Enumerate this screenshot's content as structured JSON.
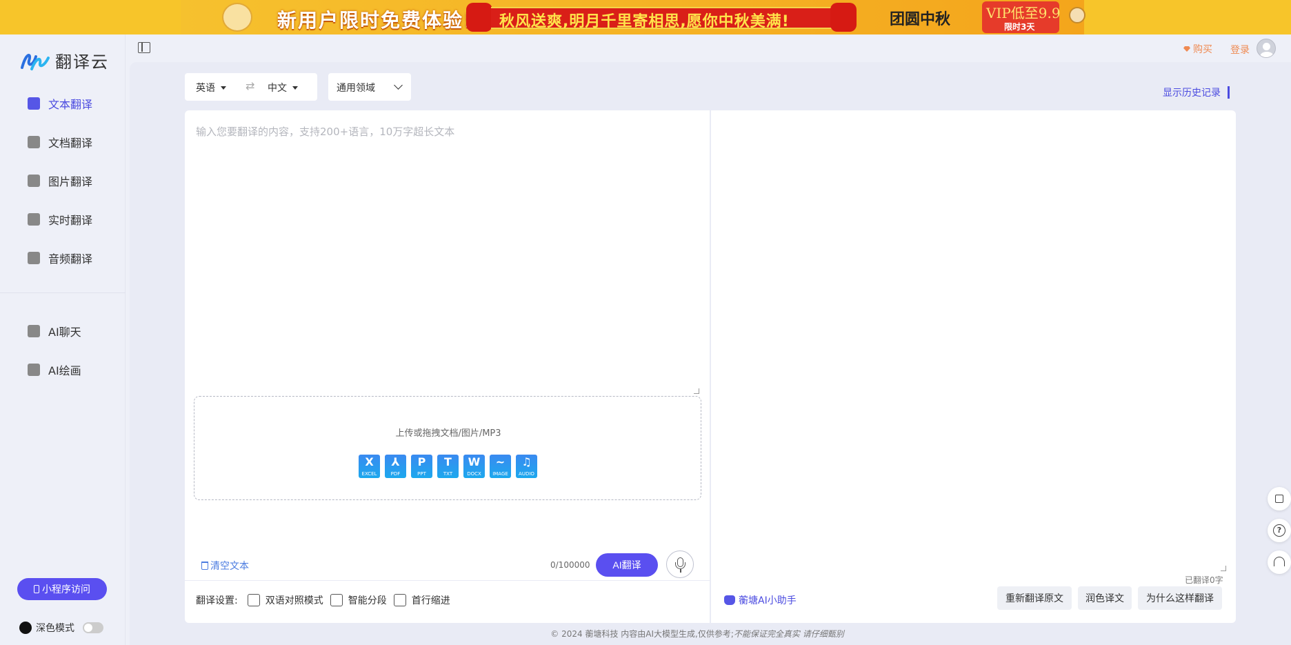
{
  "banner": {
    "headline": "新用户限时免费体验!",
    "ribbon": "秋风送爽,明月千里寄相思,愿你中秋美满!",
    "moon_text": "团圆中秋",
    "vip_text": "VIP低至9.9",
    "vip_sub": "限时3天"
  },
  "logo": {
    "text": "翻译云"
  },
  "sidebar": {
    "items": [
      {
        "label": "文本翻译",
        "icon": "text-translate-icon",
        "active": true
      },
      {
        "label": "文档翻译",
        "icon": "document-translate-icon",
        "active": false
      },
      {
        "label": "图片翻译",
        "icon": "image-translate-icon",
        "active": false
      },
      {
        "label": "实时翻译",
        "icon": "realtime-translate-icon",
        "active": false
      },
      {
        "label": "音频翻译",
        "icon": "audio-translate-icon",
        "active": false
      }
    ],
    "ai_items": [
      {
        "label": "AI聊天",
        "icon": "ai-chat-icon"
      },
      {
        "label": "AI绘画",
        "icon": "ai-paint-icon"
      }
    ],
    "mini_program": "小程序访问",
    "dark_mode": "深色模式"
  },
  "header": {
    "buy": "购买",
    "login": "登录"
  },
  "toolbar": {
    "source_lang": "英语",
    "target_lang": "中文",
    "swap_glyph": "⇄",
    "domain": "通用领域",
    "history": "显示历史记录"
  },
  "source": {
    "placeholder": "输入您要翻译的内容，支持200+语言，10万字超长文本",
    "value": ""
  },
  "upload": {
    "label": "上传或拖拽文档/图片/MP3",
    "file_types": [
      {
        "type": "EXCEL",
        "glyph": "X"
      },
      {
        "type": "PDF",
        "glyph": "⅄"
      },
      {
        "type": "PPT",
        "glyph": "P"
      },
      {
        "type": "TXT",
        "glyph": "T"
      },
      {
        "type": "DOCX",
        "glyph": "W"
      },
      {
        "type": "IMAGE",
        "glyph": "~"
      },
      {
        "type": "AUDIO",
        "glyph": "♫"
      }
    ]
  },
  "actions": {
    "clear": "清空文本",
    "count": "0/100000",
    "translate": "AI翻译"
  },
  "settings": {
    "label": "翻译设置:",
    "options": [
      "双语对照模式",
      "智能分段",
      "首行缩进"
    ]
  },
  "target": {
    "translated_count": "已翻译0字",
    "assistant": "蘅塘AI小助手",
    "buttons": [
      "重新翻译原文",
      "润色译文",
      "为什么这样翻译"
    ]
  },
  "footer": {
    "copyright": "© 2024 蘅塘科技   内容由AI大模型生成,仅供参考;",
    "disclaimer": "不能保证完全真实 请仔细甄别"
  },
  "colors": {
    "accent": "#5a4ff0",
    "buy_orange": "#ef8a52",
    "link_blue": "#4a7be0"
  }
}
